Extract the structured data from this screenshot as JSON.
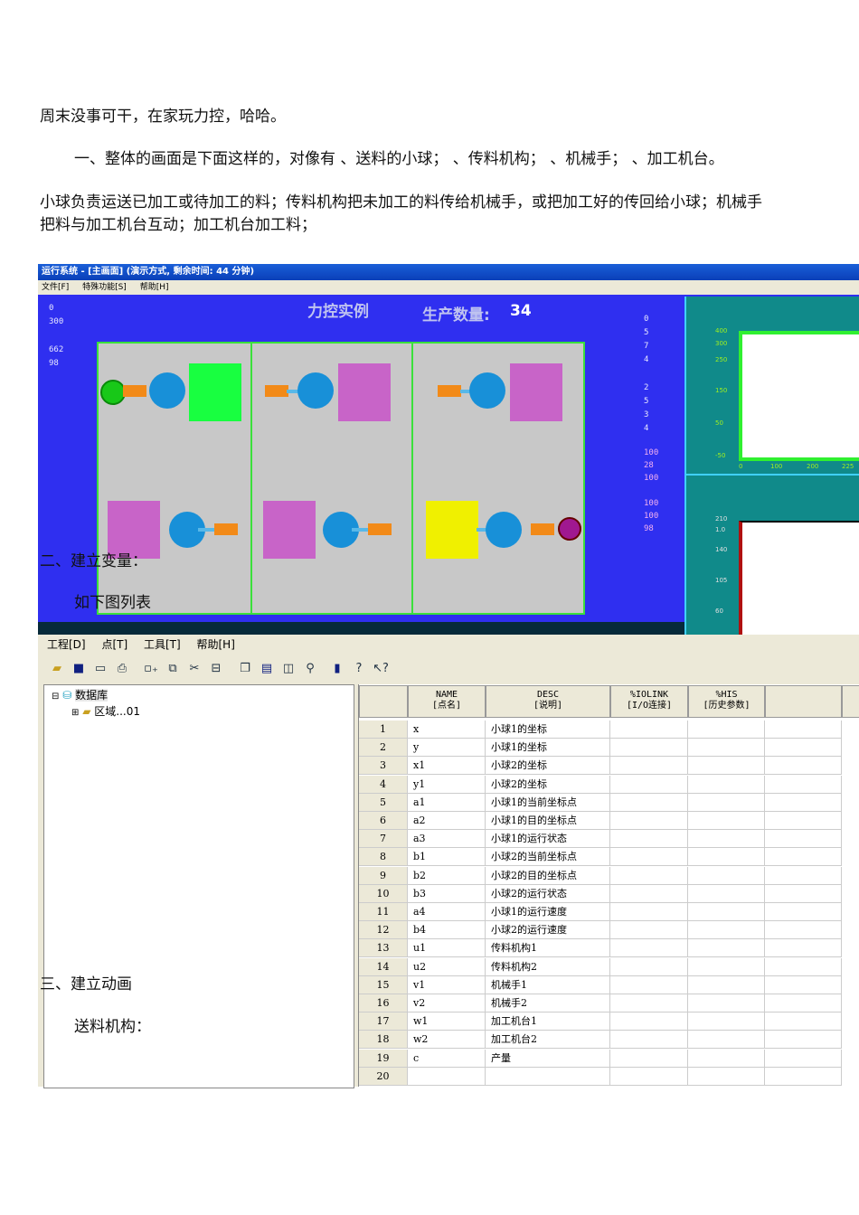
{
  "paragraphs": {
    "p1": "周末没事可干，在家玩力控，哈哈。",
    "p2": "一、整体的画面是下面这样的，对像有  、送料的小球；  、传料机构；  、机械手；  、加工机台。",
    "p3a": "小球负责运送已加工或待加工的料；传料机构把未加工的料传给机械手，或把加工好的传回给小球；机械手",
    "p3b": "把料与加工机台互动；加工机台加工料；",
    "h2": "二、建立变量：",
    "p4": "如下图列表",
    "h3": "三、建立动画",
    "p5": "送料机构："
  },
  "runtime": {
    "title": "运行系统 - [主画面] (演示方式, 剩余时间: 44 分钟)",
    "menu": [
      "文件[F]",
      "特殊功能[S]",
      "帮助[H]"
    ],
    "scene_title": "力控实例",
    "count_label": "生产数量:",
    "count_value": "34",
    "left_values": [
      "0",
      "300",
      "662",
      "98"
    ],
    "right_values_a": [
      "0",
      "5",
      "7",
      "4"
    ],
    "right_values_b": [
      "2",
      "5",
      "3",
      "4"
    ],
    "right_values_c": [
      "100",
      "28",
      "100"
    ],
    "right_values_d": [
      "100",
      "100",
      "98"
    ],
    "chart1_yticks": [
      "400",
      "300",
      "250",
      "150",
      "50",
      "-50"
    ],
    "chart1_xticks": [
      "0",
      "100",
      "200",
      "225"
    ],
    "chart2_yticks": [
      "210",
      "1.0",
      "140",
      "105",
      "60"
    ],
    "colors": {
      "background": "#2f2ff0",
      "frame": "#3be03b",
      "machine_green": "#18ff40",
      "machine_purple": "#c864c8",
      "machine_yellow": "#f0f000",
      "feeder": "#f28a18",
      "robot": "#1890d8"
    }
  },
  "editor": {
    "menu": [
      "工程[D]",
      "点[T]",
      "工具[T]",
      "帮助[H]"
    ],
    "toolbar": [
      "open-icon",
      "save-icon",
      "window-icon",
      "print-icon",
      "add-point-icon",
      "copy-point-icon",
      "cut-point-icon",
      "link-icon",
      "copy-icon",
      "paste-icon",
      "duplicate-icon",
      "find-icon",
      "exit-icon",
      "help-icon",
      "context-help-icon"
    ],
    "tree": {
      "root": "数据库",
      "child": "区域...01"
    },
    "columns": [
      {
        "code": "NAME",
        "label": "[点名]"
      },
      {
        "code": "DESC",
        "label": "[说明]"
      },
      {
        "code": "%IOLINK",
        "label": "[I/O连接]"
      },
      {
        "code": "%HIS",
        "label": "[历史参数]"
      }
    ],
    "rows": [
      {
        "n": "1",
        "name": "x",
        "desc": "小球1的坐标"
      },
      {
        "n": "2",
        "name": "y",
        "desc": "小球1的坐标"
      },
      {
        "n": "3",
        "name": "x1",
        "desc": "小球2的坐标"
      },
      {
        "n": "4",
        "name": "y1",
        "desc": "小球2的坐标"
      },
      {
        "n": "5",
        "name": "a1",
        "desc": "小球1的当前坐标点"
      },
      {
        "n": "6",
        "name": "a2",
        "desc": "小球1的目的坐标点"
      },
      {
        "n": "7",
        "name": "a3",
        "desc": "小球1的运行状态"
      },
      {
        "n": "8",
        "name": "b1",
        "desc": "小球2的当前坐标点"
      },
      {
        "n": "9",
        "name": "b2",
        "desc": "小球2的目的坐标点"
      },
      {
        "n": "10",
        "name": "b3",
        "desc": "小球2的运行状态"
      },
      {
        "n": "11",
        "name": "a4",
        "desc": "小球1的运行速度"
      },
      {
        "n": "12",
        "name": "b4",
        "desc": "小球2的运行速度"
      },
      {
        "n": "13",
        "name": "u1",
        "desc": "传料机构1"
      },
      {
        "n": "14",
        "name": "u2",
        "desc": "传料机构2"
      },
      {
        "n": "15",
        "name": "v1",
        "desc": "机械手1"
      },
      {
        "n": "16",
        "name": "v2",
        "desc": "机械手2"
      },
      {
        "n": "17",
        "name": "w1",
        "desc": "加工机台1"
      },
      {
        "n": "18",
        "name": "w2",
        "desc": "加工机台2"
      },
      {
        "n": "19",
        "name": "c",
        "desc": "产量"
      },
      {
        "n": "20",
        "name": "",
        "desc": ""
      }
    ]
  }
}
